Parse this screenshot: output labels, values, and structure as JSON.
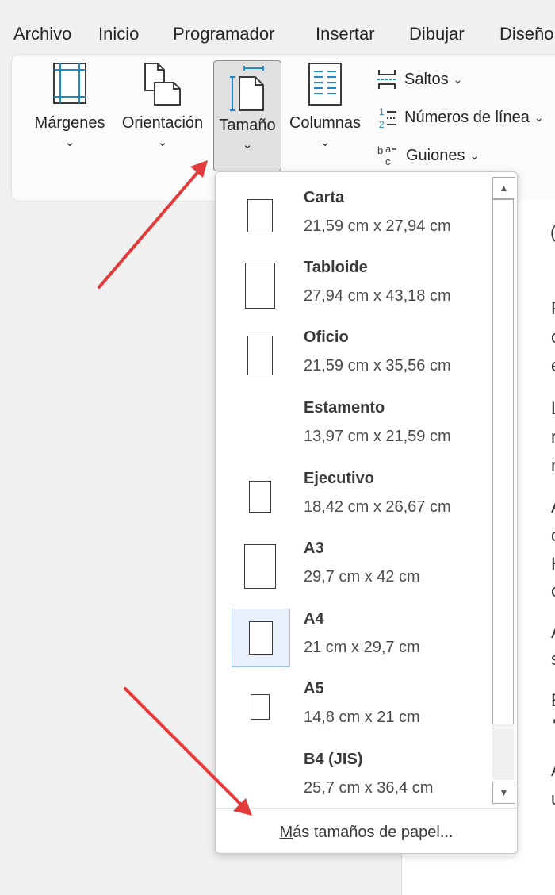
{
  "menubar": {
    "items": [
      "Archivo",
      "Inicio",
      "Programador",
      "Insertar",
      "Dibujar",
      "Diseño"
    ]
  },
  "ribbon": {
    "margins_label": "Márgenes",
    "orientation_label": "Orientación",
    "size_label": "Tamaño",
    "columns_label": "Columnas",
    "breaks_label": "Saltos",
    "line_numbers_label": "Números de línea",
    "hyphenation_label": "Guiones"
  },
  "dropdown": {
    "sizes": [
      {
        "name": "Carta",
        "dims": "21,59 cm x 27,94 cm"
      },
      {
        "name": "Tabloide",
        "dims": "27,94 cm x 43,18 cm"
      },
      {
        "name": "Oficio",
        "dims": "21,59 cm x 35,56 cm"
      },
      {
        "name": "Estamento",
        "dims": "13,97 cm x 21,59 cm"
      },
      {
        "name": "Ejecutivo",
        "dims": "18,42 cm x 26,67 cm"
      },
      {
        "name": "A3",
        "dims": "29,7 cm x 42 cm"
      },
      {
        "name": "A4",
        "dims": "21 cm x 29,7 cm"
      },
      {
        "name": "A5",
        "dims": "14,8 cm x 21 cm"
      },
      {
        "name": "B4 (JIS)",
        "dims": "25,7 cm x 36,4 cm"
      }
    ],
    "selected": "A4",
    "more_sizes_first": "M",
    "more_sizes_rest": "ás tamaños de papel..."
  },
  "document": {
    "letters": [
      "(",
      "P",
      "c",
      "e",
      "L",
      "r",
      "r",
      "A",
      "c",
      "H",
      "c",
      "A",
      "s",
      "E",
      "'",
      "A",
      "u"
    ]
  },
  "colors": {
    "accent": "#1f8ac9",
    "arrow": "#e23b3b",
    "selected_bg": "#e8f1fb"
  }
}
